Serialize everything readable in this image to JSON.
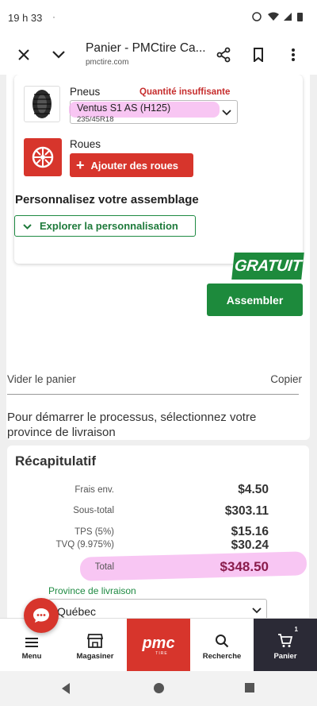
{
  "status_bar": {
    "time": "19 h 33",
    "dot": "·"
  },
  "browser": {
    "title": "Panier - PMCtire Ca...",
    "domain": "pmctire.com",
    "icons": [
      "close-icon",
      "chevron-down-icon",
      "share-icon",
      "bookmark-icon",
      "more-vert-icon"
    ]
  },
  "assembly": {
    "tires_label": "Pneus",
    "qty_warning": "Quantité insuffisante",
    "tire_name": "Ventus S1 AS (H125)",
    "tire_size": "235/45R18",
    "wheels_label": "Roues",
    "add_wheels_label": "Ajouter des roues",
    "customize_heading": "Personnalisez votre assemblage",
    "explore_label": "Explorer la personnalisation",
    "free_badge": "GRATUIT",
    "assemble_label": "Assembler"
  },
  "cart_links": {
    "empty": "Vider le panier",
    "copy": "Copier"
  },
  "province_prompt": "Pour démarrer le processus, sélectionnez votre province de livraison",
  "summary": {
    "title": "Récapitulatif",
    "rows": [
      {
        "label": "Frais env.",
        "value": "$4.50"
      },
      {
        "label": "Sous-total",
        "value": "$303.11"
      },
      {
        "label": "TPS (5%)",
        "value": "$15.16"
      },
      {
        "label": "TVQ (9.975%)",
        "value": "$30.24"
      }
    ],
    "total_label": "Total",
    "total_value": "$348.50",
    "province_label": "Province de livraison",
    "province_value": "Québec"
  },
  "bottom_nav": {
    "menu": "Menu",
    "shop": "Magasiner",
    "logo": "pmc",
    "logo_sub": "TIRE",
    "search": "Recherche",
    "cart": "Panier",
    "cart_count": "1"
  },
  "colors": {
    "brand_red": "#d7352c",
    "brand_green": "#1d8a3c",
    "highlight": "#f6b3ef"
  }
}
